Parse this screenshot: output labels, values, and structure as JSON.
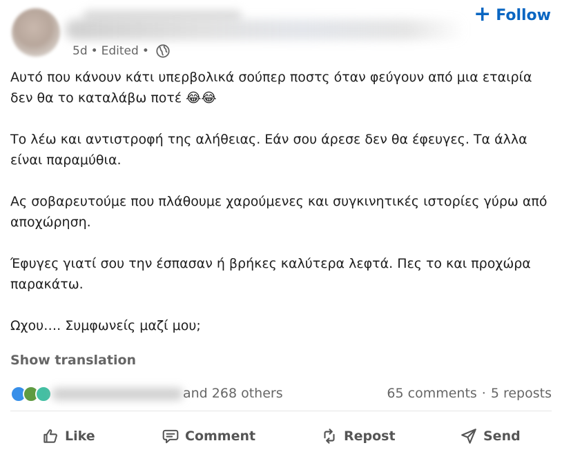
{
  "post": {
    "meta": {
      "age": "5d",
      "edited": "Edited",
      "dot": "•"
    },
    "follow_label": "Follow",
    "paragraphs": [
      "Αυτό που κάνουν κάτι υπερβολικά σούπερ ποστς όταν φεύγουν από μια εταιρία δεν θα το καταλάβω ποτέ 😂😂",
      "Το λέω και αντιστροφή της αλήθειας. Εάν σου άρεσε δεν θα έφευγες. Τα άλλα είναι παραμύθια.",
      "Ας σοβαρευτούμε που πλάθουμε χαρούμενες και συγκινητικές ιστορίες γύρω από αποχώρηση.",
      "Έφυγες γιατί σου την έσπασαν ή βρήκες καλύτερα λεφτά. Πες το και προχώρα παρακάτω.",
      "Ωχου…. Συμφωνείς μαζί μου;"
    ],
    "show_translation": "Show translation",
    "social": {
      "and_others": "and 268 others",
      "comments": "65 comments",
      "sep": "·",
      "reposts": "5 reposts"
    },
    "actions": {
      "like": "Like",
      "comment": "Comment",
      "repost": "Repost",
      "send": "Send"
    },
    "icons": {
      "globe": "globe-icon",
      "plus": "plus-icon",
      "like": "thumbs-up-icon",
      "comment": "comment-icon",
      "repost": "repost-icon",
      "send": "send-icon"
    },
    "colors": {
      "accent": "#0a66c2",
      "muted": "#666666"
    }
  }
}
